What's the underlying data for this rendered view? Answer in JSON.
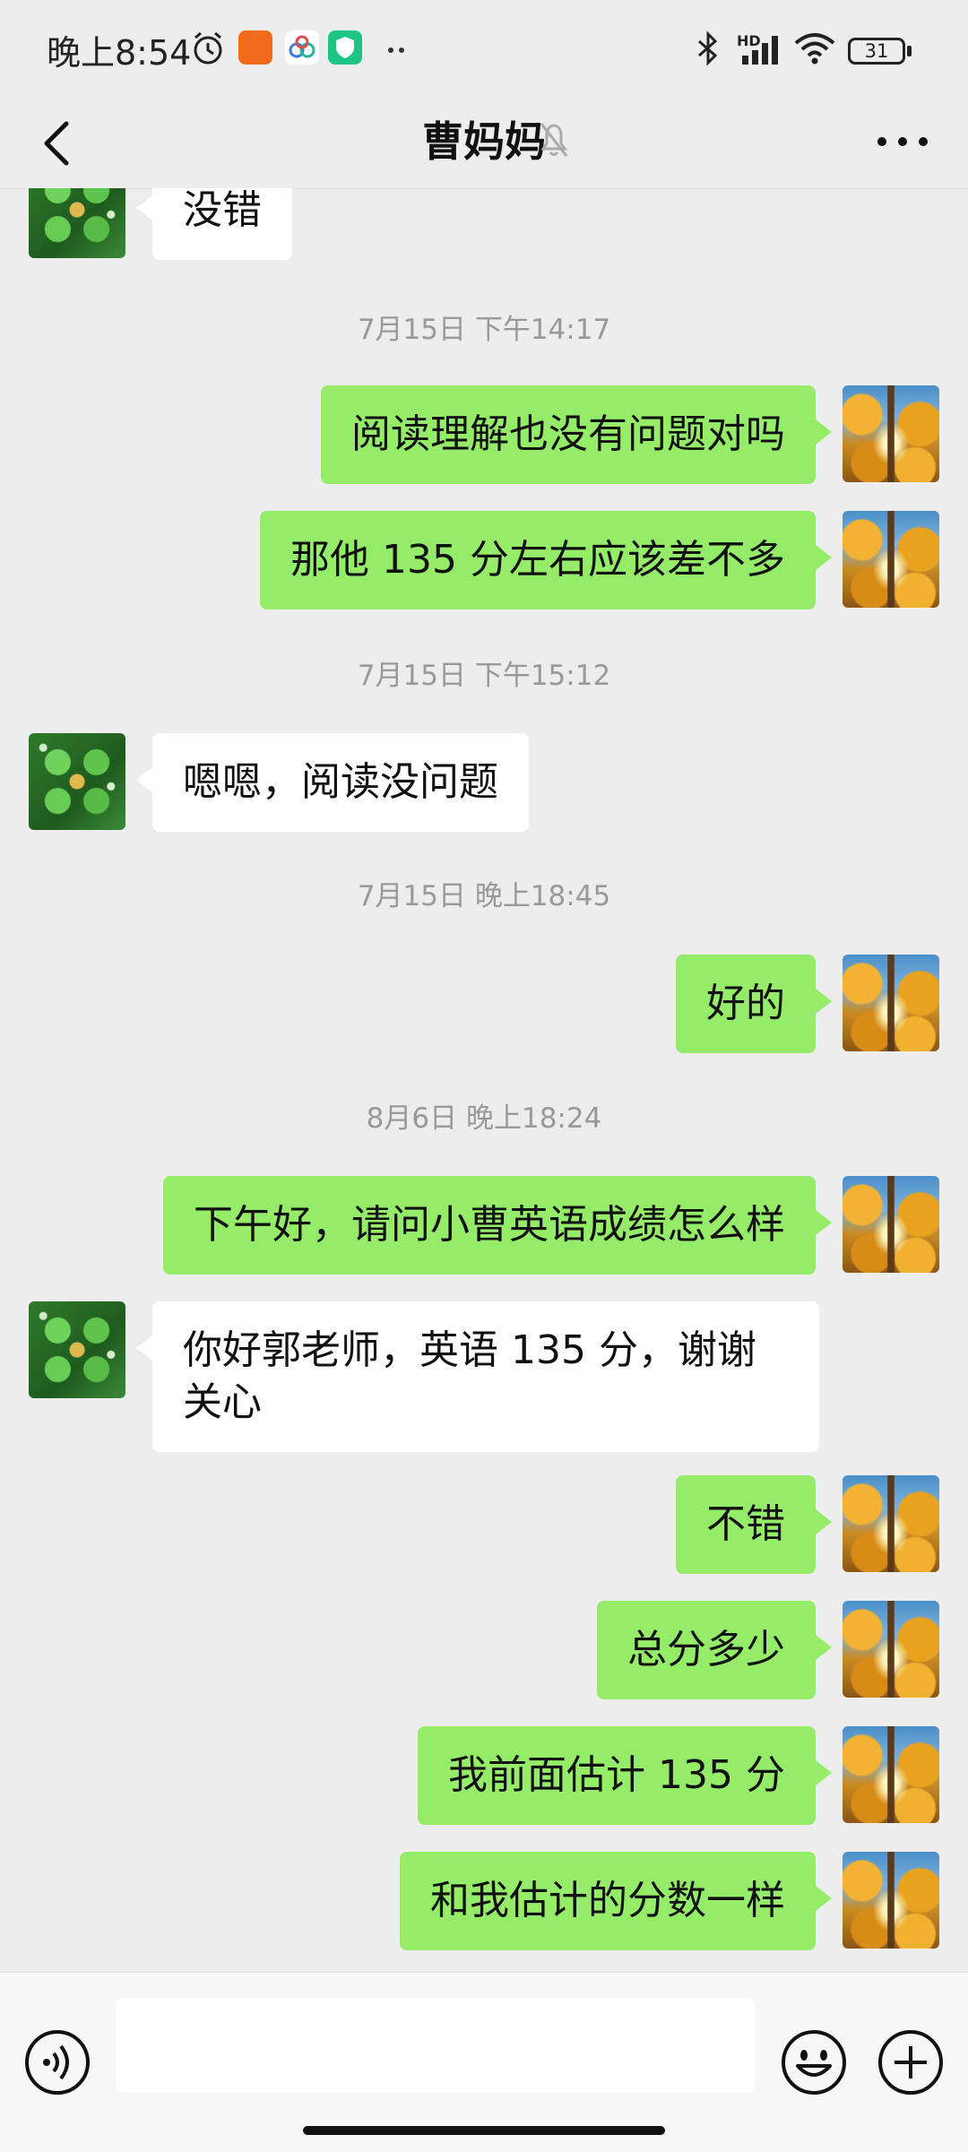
{
  "status_bar": {
    "time": "晚上8:54",
    "battery": "31",
    "network": "HD"
  },
  "header": {
    "title": "曹妈妈",
    "back_icon": "chevron-left-icon",
    "mute_icon": "bell-off-icon",
    "more_icon": "more-dots-icon"
  },
  "messages": [
    {
      "type": "msg",
      "from": "them",
      "text": "没错"
    },
    {
      "type": "time",
      "text": "7月15日 下午14:17"
    },
    {
      "type": "msg",
      "from": "me",
      "text": "阅读理解也没有问题对吗"
    },
    {
      "type": "msg",
      "from": "me",
      "text": "那他 135 分左右应该差不多"
    },
    {
      "type": "time",
      "text": "7月15日 下午15:12"
    },
    {
      "type": "msg",
      "from": "them",
      "text": "嗯嗯，阅读没问题"
    },
    {
      "type": "time",
      "text": "7月15日 晚上18:45"
    },
    {
      "type": "msg",
      "from": "me",
      "text": "好的"
    },
    {
      "type": "time",
      "text": "8月6日 晚上18:24"
    },
    {
      "type": "msg",
      "from": "me",
      "text": "下午好，请问小曹英语成绩怎么样"
    },
    {
      "type": "msg",
      "from": "them",
      "text": "你好郭老师，英语 135 分，谢谢关心"
    },
    {
      "type": "msg",
      "from": "me",
      "text": "不错"
    },
    {
      "type": "msg",
      "from": "me",
      "text": "总分多少"
    },
    {
      "type": "msg",
      "from": "me",
      "text": "我前面估计 135 分"
    },
    {
      "type": "msg",
      "from": "me",
      "text": "和我估计的分数一样"
    }
  ],
  "input_bar": {
    "voice_icon": "voice-icon",
    "text_value": "",
    "emoji_icon": "emoji-icon",
    "plus_icon": "plus-icon"
  },
  "colors": {
    "background": "#ededed",
    "my_bubble": "#95ec69",
    "their_bubble": "#ffffff"
  }
}
